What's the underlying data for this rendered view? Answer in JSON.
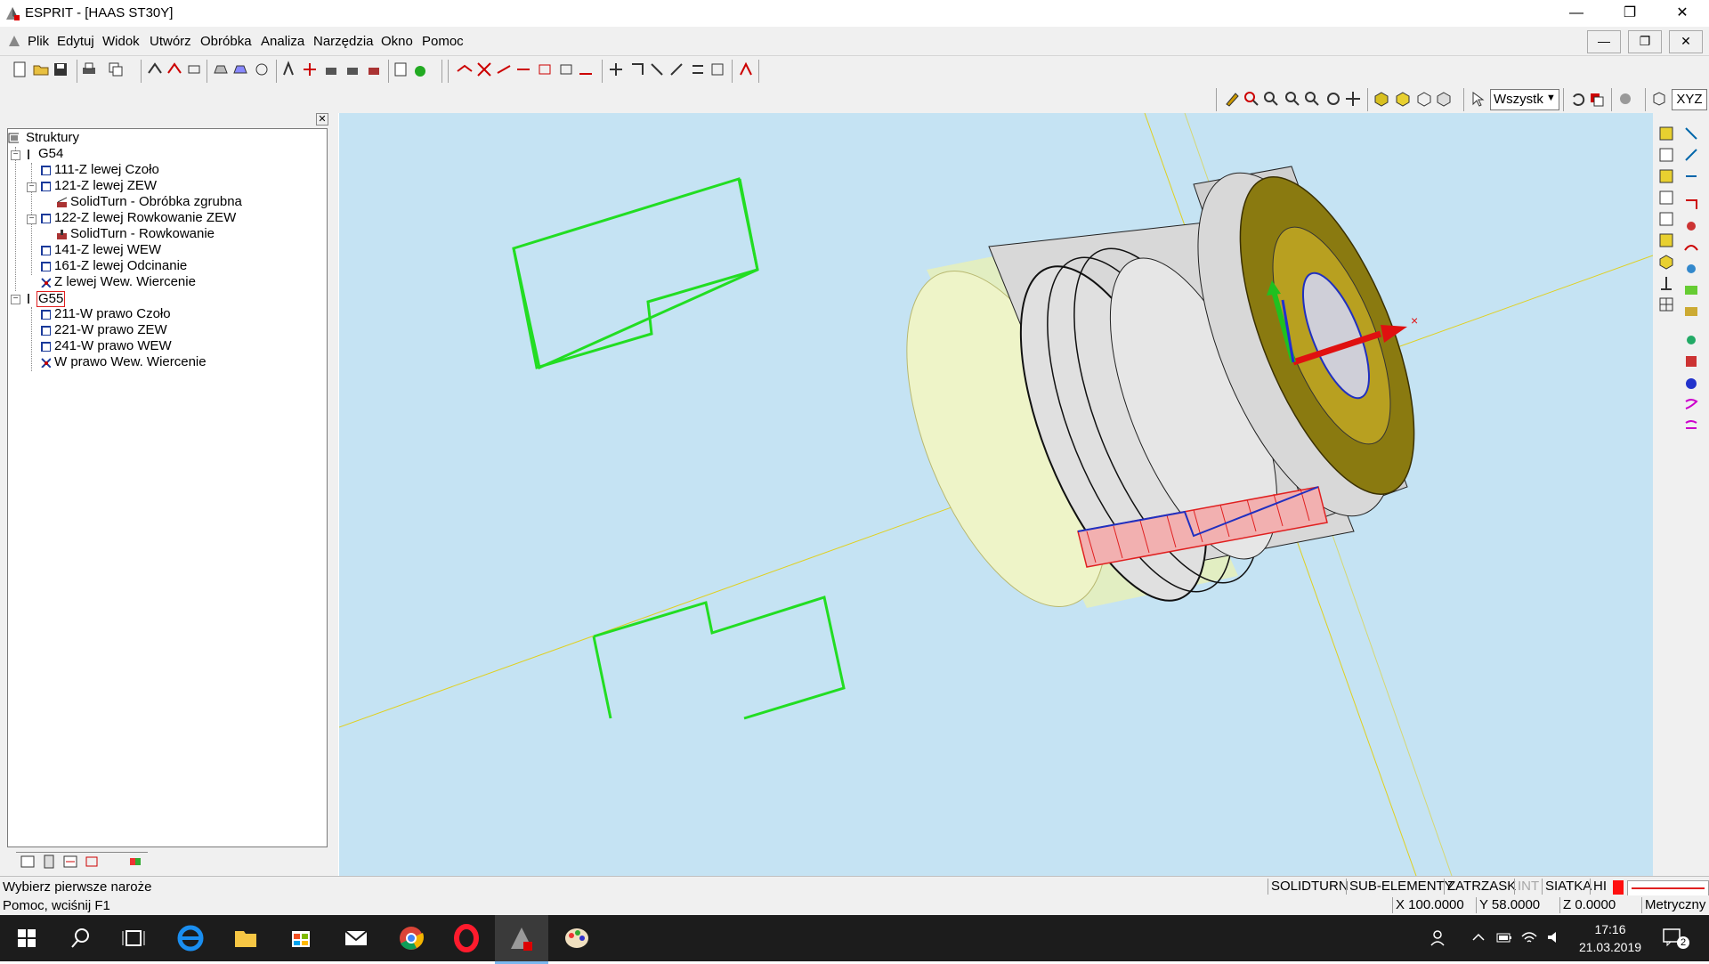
{
  "window": {
    "title": "ESPRIT - [HAAS ST30Y]"
  },
  "menu": {
    "items": [
      "Plik",
      "Edytuj",
      "Widok",
      "Utwórz",
      "Obróbka",
      "Analiza",
      "Narzędzia",
      "Okno",
      "Pomoc"
    ]
  },
  "view_toolbar": {
    "filter_select": "Wszystk",
    "xyz_label": "XYZ"
  },
  "tree": {
    "root": "Struktury",
    "groups": [
      {
        "label": "G54",
        "items": [
          {
            "label": "111-Z lewej Czoło",
            "children": []
          },
          {
            "label": "121-Z lewej ZEW",
            "children": [
              "SolidTurn - Obróbka zgrubna"
            ]
          },
          {
            "label": "122-Z lewej Rowkowanie ZEW",
            "children": [
              "SolidTurn - Rowkowanie"
            ]
          },
          {
            "label": "141-Z lewej WEW",
            "children": []
          },
          {
            "label": "161-Z lewej Odcinanie",
            "children": []
          },
          {
            "label": "Z lewej Wew. Wiercenie",
            "children": []
          }
        ]
      },
      {
        "label": "G55",
        "items": [
          {
            "label": "211-W prawo Czoło",
            "children": []
          },
          {
            "label": "221-W prawo ZEW",
            "children": []
          },
          {
            "label": "241-W prawo WEW",
            "children": []
          },
          {
            "label": "W prawo Wew. Wiercenie",
            "children": []
          }
        ]
      }
    ]
  },
  "status": {
    "prompt": "Wybierz pierwsze naroże",
    "help": "Pomoc, wciśnij F1",
    "modes": [
      "SOLIDTURN",
      "SUB-ELEMENTY",
      "ZATRZASK",
      "INT",
      "SIATKA",
      "HI"
    ],
    "x": "X 100.0000",
    "y": "Y 58.0000",
    "z": "Z 0.0000",
    "units": "Metryczny"
  },
  "taskbar": {
    "time": "17:16",
    "date": "21.03.2019",
    "notifications": "2"
  },
  "colors": {
    "viewport_bg": "#c5e3f3",
    "toolpath_green": "#22dd22",
    "axis_red": "#e01010"
  }
}
